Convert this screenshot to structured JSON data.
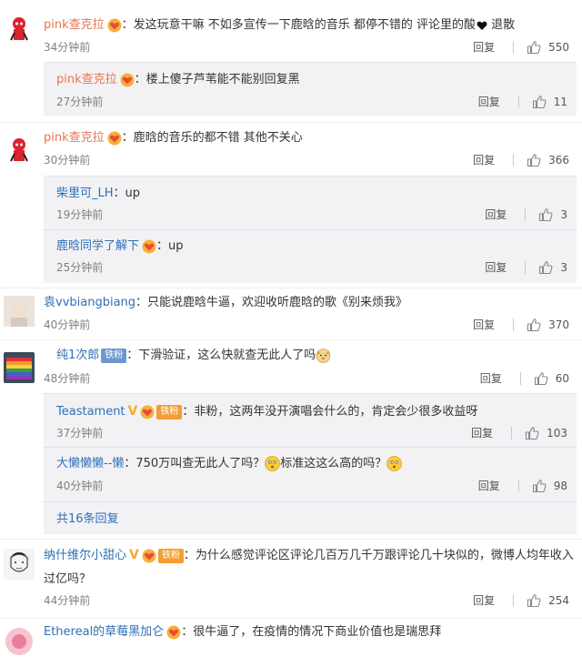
{
  "comments": [
    {
      "user": "pink查克拉",
      "text": "：发这玩意干嘛 不如多宣传一下鹿晗的音乐 都停不错的 评论里的酸",
      "text_tail": " 退散",
      "time": "34分钟前",
      "reply": "回复",
      "likes": "550",
      "avatar": "red-character",
      "replies": [
        {
          "user": "pink查克拉",
          "text": "：楼上傻子芦苇能不能别回复黑",
          "time": "27分钟前",
          "reply": "回复",
          "likes": "11"
        }
      ]
    },
    {
      "user": "pink查克拉",
      "text": "：鹿晗的音乐的都不错 其他不关心",
      "time": "30分钟前",
      "reply": "回复",
      "likes": "366",
      "avatar": "red-character",
      "replies": [
        {
          "user": "柴里可_LH",
          "text": "：up",
          "time": "19分钟前",
          "reply": "回复",
          "likes": "3"
        },
        {
          "user": "鹿晗同学了解下",
          "text": "：up",
          "time": "25分钟前",
          "reply": "回复",
          "likes": "3"
        }
      ]
    },
    {
      "user": "袁vvbiangbiang",
      "text": "：只能说鹿晗牛逼，欢迎收听鹿晗的歌《别来烦我》",
      "time": "40分钟前",
      "reply": "回复",
      "likes": "370",
      "avatar": "blonde-person"
    },
    {
      "user": "纯1次郎",
      "badge": "铁粉",
      "text": "：下滑验证，这么快就查无此人了吗",
      "time": "48分钟前",
      "reply": "回复",
      "likes": "60",
      "avatar": "rainbow-flag",
      "replies": [
        {
          "user": "Teastament",
          "badge": "铁粉",
          "text": "：非粉，这两年没开演唱会什么的，肯定会少很多收益呀",
          "time": "37分钟前",
          "reply": "回复",
          "likes": "103"
        },
        {
          "user": "大懒懒懒--懒",
          "text": "：750万叫查无此人了吗？",
          "text_mid": "标准这这么高的吗？",
          "time": "40分钟前",
          "reply": "回复",
          "likes": "98"
        }
      ],
      "more_replies": "共16条回复"
    },
    {
      "user": "纳什维尔小甜心",
      "badge": "铁粉",
      "text": "：为什么感觉评论区评论几百万几千万跟评论几十块似的，微博人均年收入过亿吗？",
      "time": "44分钟前",
      "reply": "回复",
      "likes": "254",
      "avatar": "sketch-face"
    },
    {
      "user": "Ethereal的草莓黑加仑",
      "text": "：很牛逼了，在疫情的情况下商业价值也是瑞思拜",
      "avatar": "pink-circle"
    }
  ],
  "icons": {
    "thumb": "thumbs-up-icon",
    "vip": "vip-heart-icon",
    "verified": "verified-v-icon"
  },
  "colors": {
    "username": "#eb7350",
    "link": "#2f6fb7",
    "subbg": "#f2f2f5"
  }
}
